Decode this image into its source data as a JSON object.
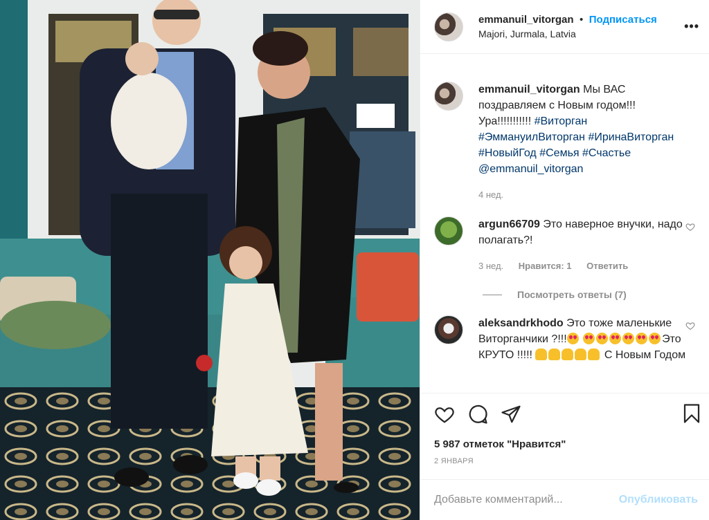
{
  "post": {
    "username": "emmanuil_vitorgan",
    "separator": "•",
    "follow_label": "Подписаться",
    "location": "Majori, Jurmala, Latvia",
    "more_label": "•••"
  },
  "caption": {
    "username": "emmanuil_vitorgan",
    "text": "Мы ВАС поздравляем с Новым годом!!! Ура!!!!!!!!!!! ",
    "tags": [
      "#Виторган",
      "#ЭммануилВиторган",
      "#ИринаВиторган",
      "#НовыйГод",
      "#Семья",
      "#Счастье",
      "@emmanuil_vitorgan"
    ],
    "time": "4 нед."
  },
  "comments": [
    {
      "username": "argun66709",
      "text": "Это наверное внучки, надо полагать?!",
      "time": "3 нед.",
      "likes": "Нравится: 1",
      "reply": "Ответить",
      "view_replies": "Посмотреть ответы (7)"
    },
    {
      "username": "aleksandrkhodo",
      "text_a": "Это тоже маленькие Виторганчики ?!!!",
      "text_b": "Это КРУТО !!!!!",
      "text_c": "С Новым Годом"
    }
  ],
  "footer": {
    "likes": "5 987 отметок \"Нравится\"",
    "date": "2 ЯНВАРЯ",
    "comment_placeholder": "Добавьте комментарий...",
    "publish_label": "Опубликовать"
  },
  "icons": [
    "heart-icon",
    "comment-icon",
    "share-icon",
    "bookmark-icon"
  ],
  "colors": {
    "link": "#0095f6",
    "tag": "#00376b",
    "muted": "#8e8e8e",
    "publish_disabled": "#b2dffc"
  }
}
